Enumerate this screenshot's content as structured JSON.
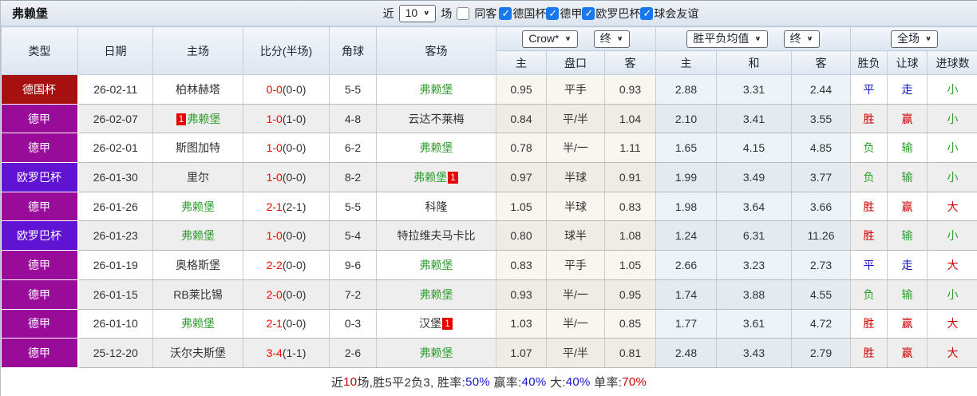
{
  "topbar": {
    "title": "弗赖堡",
    "near_label": "近",
    "count_value": "10",
    "games_label": "场",
    "same_away": {
      "label": "同客",
      "checked": false
    },
    "filters": [
      {
        "label": "德国杯",
        "checked": true
      },
      {
        "label": "德甲",
        "checked": true
      },
      {
        "label": "欧罗巴杯",
        "checked": true
      },
      {
        "label": "球会友谊",
        "checked": true
      }
    ]
  },
  "table": {
    "left_columns": [
      "类型",
      "日期",
      "主场",
      "比分(半场)",
      "角球",
      "客场"
    ],
    "dropdowns": {
      "odds_source": "Crow*",
      "odds_time": "终",
      "mean": "胜平负均值",
      "mean_time": "终",
      "scope": "全场"
    },
    "sub_columns": [
      "主",
      "盘口",
      "客",
      "主",
      "和",
      "客",
      "胜负",
      "让球",
      "进球数"
    ],
    "type_colors": {
      "德国杯": "#a61010",
      "德甲": "#990b99",
      "欧罗巴杯": "#6013d3"
    },
    "rows": [
      {
        "type": "德国杯",
        "date": "26-02-11",
        "home": "柏林赫塔",
        "home_color": "black",
        "home_badge": "",
        "away": "弗赖堡",
        "away_color": "green",
        "away_badge": "",
        "score": "0-0",
        "half": "(0-0)",
        "corner": "5-5",
        "odds_home": "0.95",
        "handicap": "平手",
        "odds_away": "0.93",
        "mean_home": "2.88",
        "mean_draw": "3.31",
        "mean_away": "2.44",
        "wdl": {
          "t": "平",
          "c": "blue"
        },
        "let": {
          "t": "走",
          "c": "blue"
        },
        "goals": {
          "t": "小",
          "c": "green"
        }
      },
      {
        "type": "德甲",
        "date": "26-02-07",
        "home": "弗赖堡",
        "home_color": "green",
        "home_badge": "1",
        "away": "云达不莱梅",
        "away_color": "black",
        "away_badge": "",
        "score": "1-0",
        "half": "(1-0)",
        "corner": "4-8",
        "odds_home": "0.84",
        "handicap": "平/半",
        "odds_away": "1.04",
        "mean_home": "2.10",
        "mean_draw": "3.41",
        "mean_away": "3.55",
        "wdl": {
          "t": "胜",
          "c": "red"
        },
        "let": {
          "t": "赢",
          "c": "red"
        },
        "goals": {
          "t": "小",
          "c": "green"
        }
      },
      {
        "type": "德甲",
        "date": "26-02-01",
        "home": "斯图加特",
        "home_color": "black",
        "home_badge": "",
        "away": "弗赖堡",
        "away_color": "green",
        "away_badge": "",
        "score": "1-0",
        "half": "(0-0)",
        "corner": "6-2",
        "odds_home": "0.78",
        "handicap": "半/一",
        "odds_away": "1.11",
        "mean_home": "1.65",
        "mean_draw": "4.15",
        "mean_away": "4.85",
        "wdl": {
          "t": "负",
          "c": "green"
        },
        "let": {
          "t": "输",
          "c": "green"
        },
        "goals": {
          "t": "小",
          "c": "green"
        }
      },
      {
        "type": "欧罗巴杯",
        "date": "26-01-30",
        "home": "里尔",
        "home_color": "black",
        "home_badge": "",
        "away": "弗赖堡",
        "away_color": "green",
        "away_badge": "1",
        "score": "1-0",
        "half": "(0-0)",
        "corner": "8-2",
        "odds_home": "0.97",
        "handicap": "半球",
        "odds_away": "0.91",
        "mean_home": "1.99",
        "mean_draw": "3.49",
        "mean_away": "3.77",
        "wdl": {
          "t": "负",
          "c": "green"
        },
        "let": {
          "t": "输",
          "c": "green"
        },
        "goals": {
          "t": "小",
          "c": "green"
        }
      },
      {
        "type": "德甲",
        "date": "26-01-26",
        "home": "弗赖堡",
        "home_color": "green",
        "home_badge": "",
        "away": "科隆",
        "away_color": "black",
        "away_badge": "",
        "score": "2-1",
        "half": "(2-1)",
        "corner": "5-5",
        "odds_home": "1.05",
        "handicap": "半球",
        "odds_away": "0.83",
        "mean_home": "1.98",
        "mean_draw": "3.64",
        "mean_away": "3.66",
        "wdl": {
          "t": "胜",
          "c": "red"
        },
        "let": {
          "t": "赢",
          "c": "red"
        },
        "goals": {
          "t": "大",
          "c": "red"
        }
      },
      {
        "type": "欧罗巴杯",
        "date": "26-01-23",
        "home": "弗赖堡",
        "home_color": "green",
        "home_badge": "",
        "away": "特拉维夫马卡比",
        "away_color": "black",
        "away_badge": "",
        "score": "1-0",
        "half": "(0-0)",
        "corner": "5-4",
        "odds_home": "0.80",
        "handicap": "球半",
        "odds_away": "1.08",
        "mean_home": "1.24",
        "mean_draw": "6.31",
        "mean_away": "11.26",
        "wdl": {
          "t": "胜",
          "c": "red"
        },
        "let": {
          "t": "输",
          "c": "green"
        },
        "goals": {
          "t": "小",
          "c": "green"
        }
      },
      {
        "type": "德甲",
        "date": "26-01-19",
        "home": "奥格斯堡",
        "home_color": "black",
        "home_badge": "",
        "away": "弗赖堡",
        "away_color": "green",
        "away_badge": "",
        "score": "2-2",
        "half": "(0-0)",
        "corner": "9-6",
        "odds_home": "0.83",
        "handicap": "平手",
        "odds_away": "1.05",
        "mean_home": "2.66",
        "mean_draw": "3.23",
        "mean_away": "2.73",
        "wdl": {
          "t": "平",
          "c": "blue"
        },
        "let": {
          "t": "走",
          "c": "blue"
        },
        "goals": {
          "t": "大",
          "c": "red"
        }
      },
      {
        "type": "德甲",
        "date": "26-01-15",
        "home": "RB莱比锡",
        "home_color": "black",
        "home_badge": "",
        "away": "弗赖堡",
        "away_color": "green",
        "away_badge": "",
        "score": "2-0",
        "half": "(0-0)",
        "corner": "7-2",
        "odds_home": "0.93",
        "handicap": "半/一",
        "odds_away": "0.95",
        "mean_home": "1.74",
        "mean_draw": "3.88",
        "mean_away": "4.55",
        "wdl": {
          "t": "负",
          "c": "green"
        },
        "let": {
          "t": "输",
          "c": "green"
        },
        "goals": {
          "t": "小",
          "c": "green"
        }
      },
      {
        "type": "德甲",
        "date": "26-01-10",
        "home": "弗赖堡",
        "home_color": "green",
        "home_badge": "",
        "away": "汉堡",
        "away_color": "black",
        "away_badge": "1",
        "score": "2-1",
        "half": "(0-0)",
        "corner": "0-3",
        "odds_home": "1.03",
        "handicap": "半/一",
        "odds_away": "0.85",
        "mean_home": "1.77",
        "mean_draw": "3.61",
        "mean_away": "4.72",
        "wdl": {
          "t": "胜",
          "c": "red"
        },
        "let": {
          "t": "赢",
          "c": "red"
        },
        "goals": {
          "t": "大",
          "c": "red"
        }
      },
      {
        "type": "德甲",
        "date": "25-12-20",
        "home": "沃尔夫斯堡",
        "home_color": "black",
        "home_badge": "",
        "away": "弗赖堡",
        "away_color": "green",
        "away_badge": "",
        "score": "3-4",
        "half": "(1-1)",
        "corner": "2-6",
        "odds_home": "1.07",
        "handicap": "平/半",
        "odds_away": "0.81",
        "mean_home": "2.48",
        "mean_draw": "3.43",
        "mean_away": "2.79",
        "wdl": {
          "t": "胜",
          "c": "red"
        },
        "let": {
          "t": "赢",
          "c": "red"
        },
        "goals": {
          "t": "大",
          "c": "red"
        }
      }
    ]
  },
  "footer": {
    "segments": [
      {
        "t": "近",
        "c": "black"
      },
      {
        "t": "10",
        "c": "red"
      },
      {
        "t": "场,胜5平2负3, 胜率:",
        "c": "black"
      },
      {
        "t": "50%",
        "c": "blue"
      },
      {
        "t": " 赢率:",
        "c": "black"
      },
      {
        "t": "40%",
        "c": "blue"
      },
      {
        "t": " 大:",
        "c": "black"
      },
      {
        "t": "40%",
        "c": "blue"
      },
      {
        "t": " 单率:",
        "c": "black"
      },
      {
        "t": "70%",
        "c": "red"
      }
    ]
  }
}
